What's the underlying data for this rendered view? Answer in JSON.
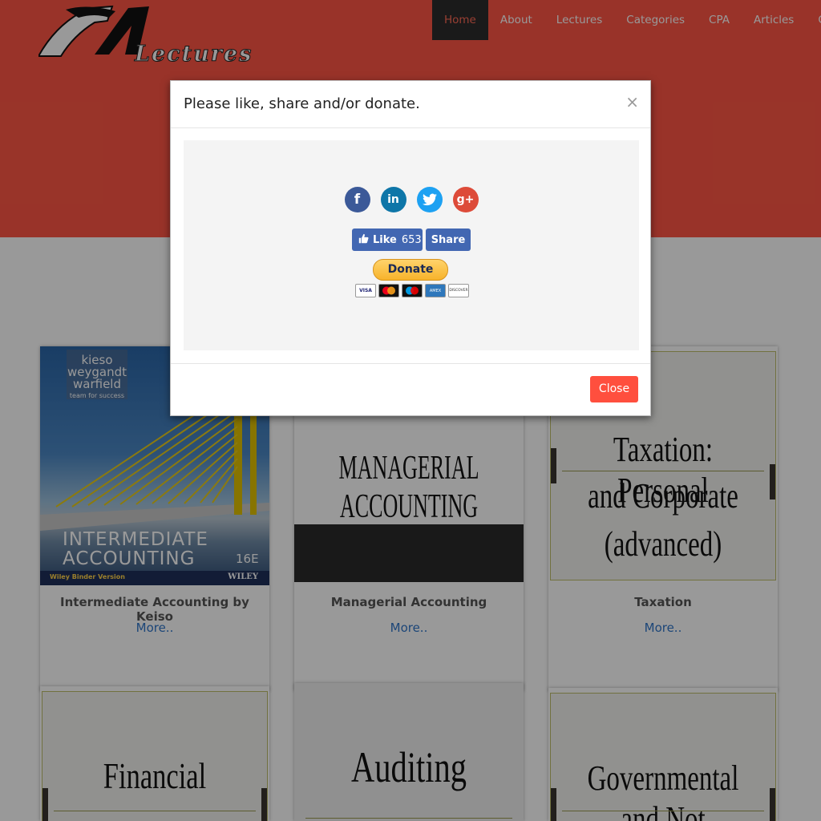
{
  "logo": {
    "text": "Lectures"
  },
  "nav": {
    "items": [
      {
        "label": "Home",
        "active": true
      },
      {
        "label": "About"
      },
      {
        "label": "Lectures"
      },
      {
        "label": "Categories"
      },
      {
        "label": "CPA"
      },
      {
        "label": "Articles"
      },
      {
        "label": "Con"
      }
    ]
  },
  "cards": [
    {
      "title": "Intermediate Accounting by Keiso",
      "more": "More..",
      "book": {
        "authors": [
          "kieso",
          "weygandt",
          "warfield"
        ],
        "tagline": "team for success",
        "title1": "INTERMEDIATE",
        "title2": "ACCOUNTING",
        "edition": "16E",
        "binder": "Wiley Binder Version",
        "publisher": "WILEY"
      }
    },
    {
      "title": "Managerial Accounting",
      "more": "More..",
      "slide": "MANAGERIAL ACCOUNTING"
    },
    {
      "title": "Taxation",
      "more": "More..",
      "slide_lines": [
        "Taxation:  Personal",
        "and Corporate",
        "(advanced)"
      ]
    },
    {
      "slide": "Financial"
    },
    {
      "slide": "Auditing"
    },
    {
      "slide": "Governmental and Not"
    }
  ],
  "modal": {
    "title": "Please like, share and/or donate.",
    "close_x": "×",
    "social": [
      {
        "icon": "facebook-icon",
        "glyph": "f",
        "color": "#3b5998"
      },
      {
        "icon": "linkedin-icon",
        "glyph": "in",
        "color": "#0e76a8"
      },
      {
        "icon": "twitter-icon",
        "glyph": "t",
        "color": "#1da1f2"
      },
      {
        "icon": "google-plus-icon",
        "glyph": "g+",
        "color": "#dd4b39"
      }
    ],
    "like_label": "Like",
    "like_count": "653",
    "share_label": "Share",
    "donate_label": "Donate",
    "cards": [
      "VISA",
      "MC",
      "MAESTRO",
      "AMEX",
      "DISCOVER"
    ],
    "close_label": "Close"
  },
  "colors": {
    "brand": "#ff5645",
    "nav_active_bg": "#2c2c2c",
    "link": "#2f75c9",
    "facebook": "#4267b2"
  }
}
